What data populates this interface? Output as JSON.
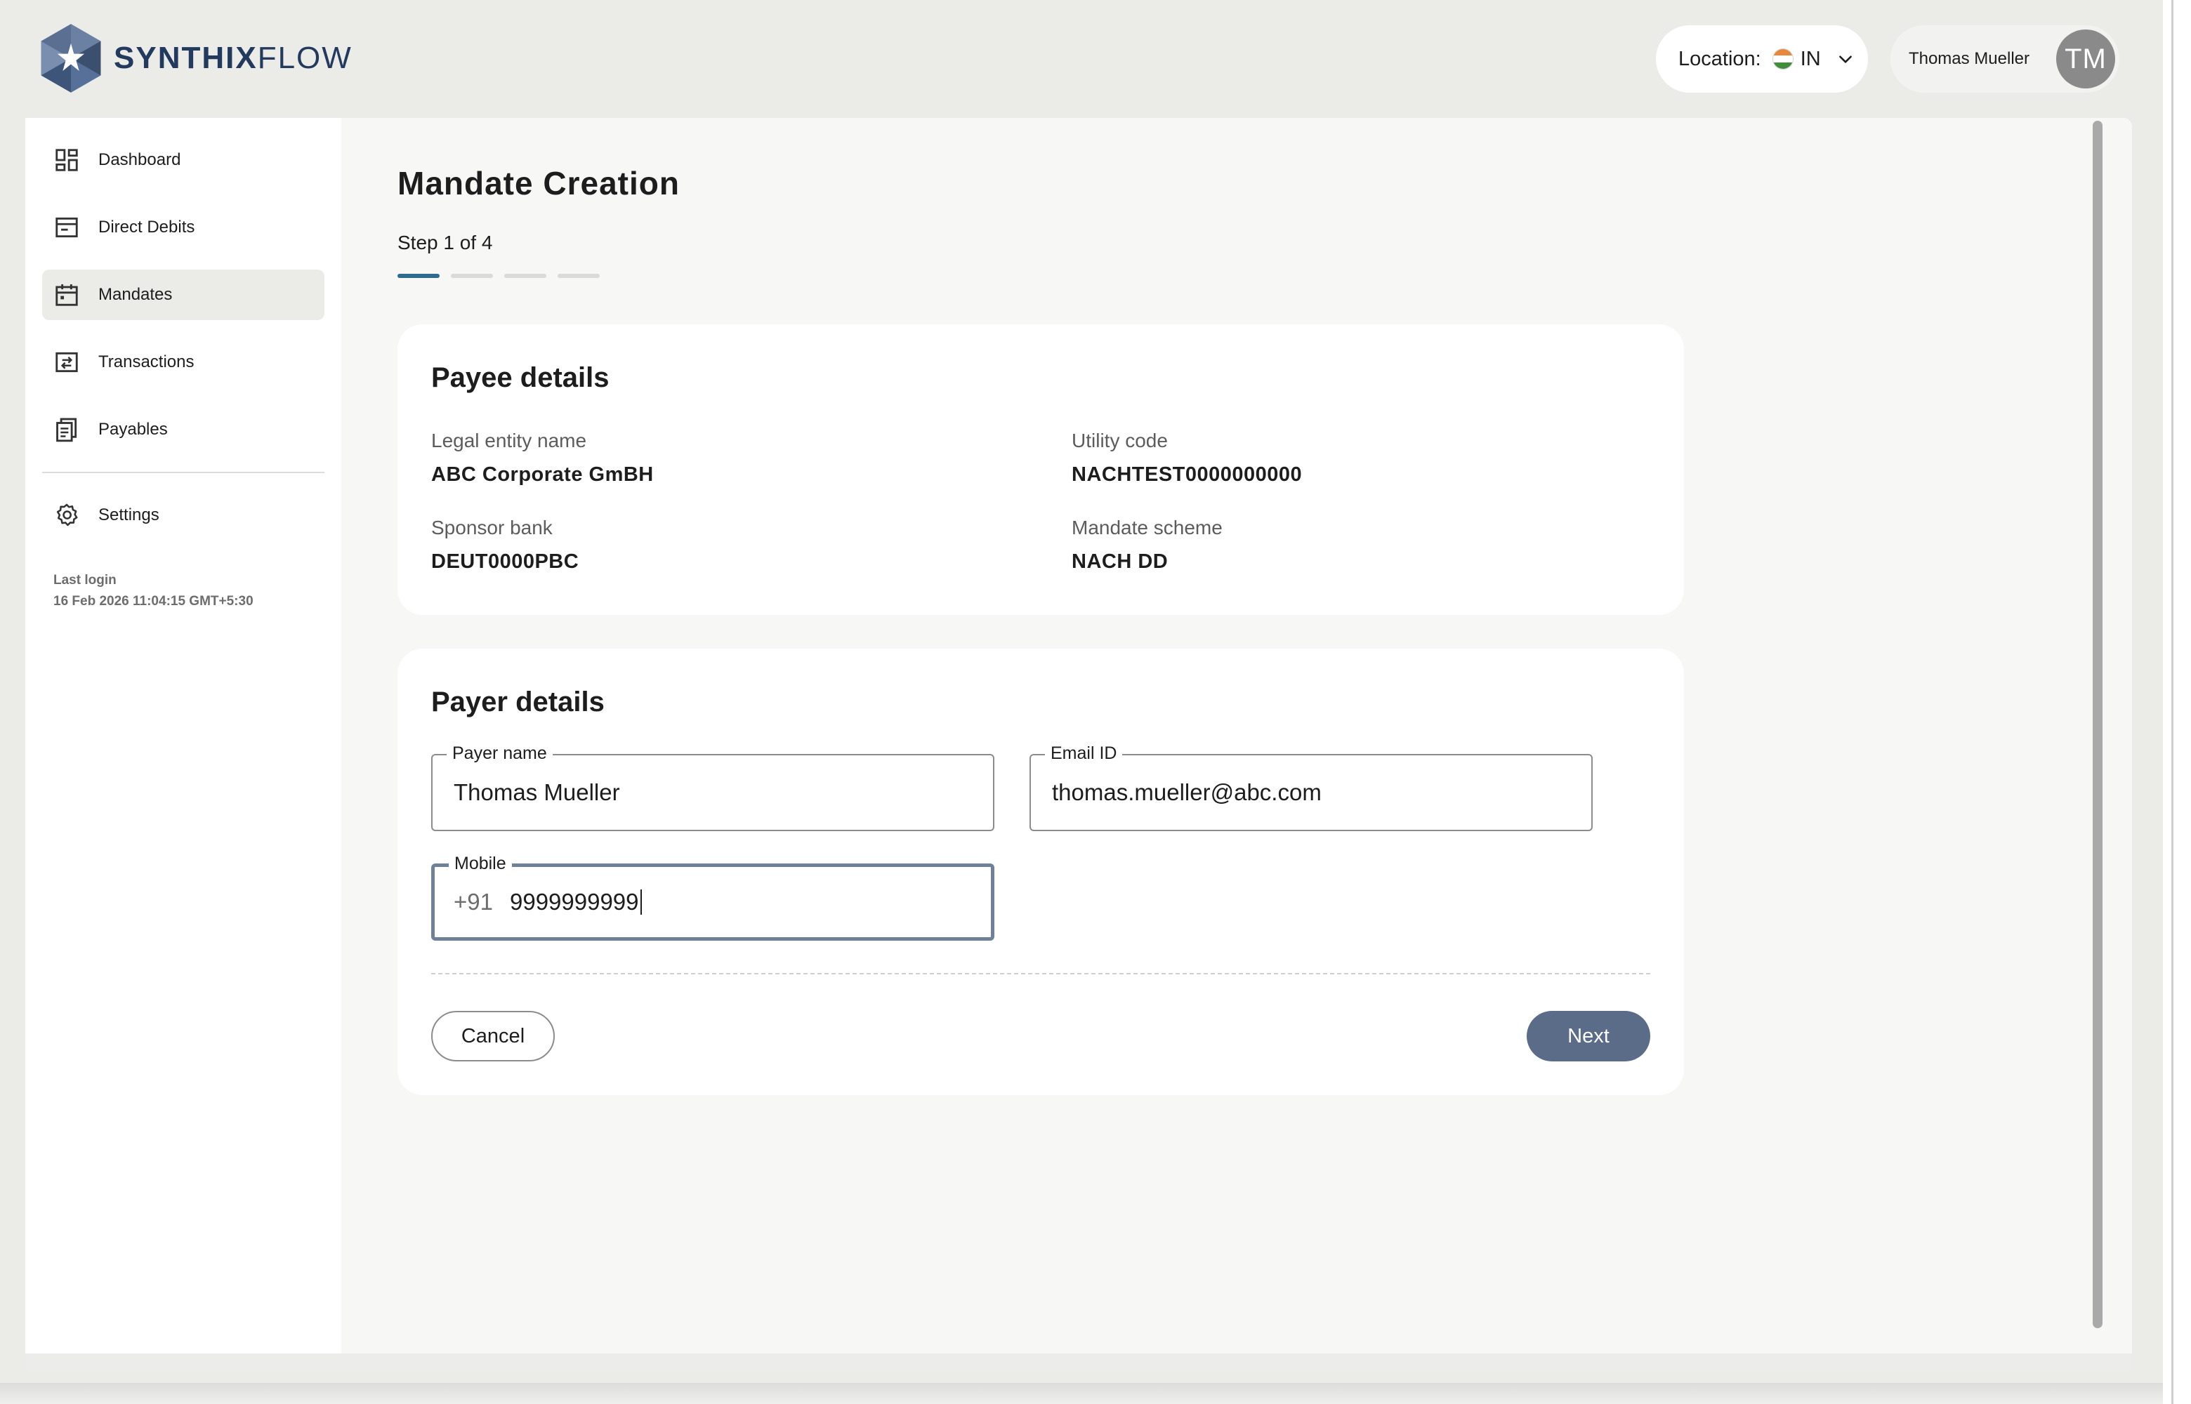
{
  "brand": {
    "name_bold": "SYNTHIX",
    "name_light": "FLOW",
    "primary": "#223a5e"
  },
  "header": {
    "location_label": "Location:",
    "location_code": "IN",
    "user_name": "Thomas Mueller",
    "user_initials": "TM"
  },
  "sidebar": {
    "items": [
      {
        "label": "Dashboard",
        "icon": "dashboard-icon"
      },
      {
        "label": "Direct Debits",
        "icon": "direct-debit-icon"
      },
      {
        "label": "Mandates",
        "icon": "calendar-icon",
        "active": true
      },
      {
        "label": "Transactions",
        "icon": "transfer-icon"
      },
      {
        "label": "Payables",
        "icon": "documents-icon"
      }
    ],
    "settings_label": "Settings",
    "last_login_label": "Last login",
    "last_login_value": "16 Feb 2026 11:04:15 GMT+5:30"
  },
  "page": {
    "title": "Mandate Creation",
    "step_label": "Step 1 of 4",
    "current_step": 1,
    "total_steps": 4
  },
  "payee": {
    "title": "Payee details",
    "fields": [
      {
        "label": "Legal entity name",
        "value": "ABC Corporate GmBH"
      },
      {
        "label": "Utility code",
        "value": "NACHTEST0000000000"
      },
      {
        "label": "Sponsor bank",
        "value": "DEUT0000PBC"
      },
      {
        "label": "Mandate scheme",
        "value": "NACH DD"
      }
    ]
  },
  "payer": {
    "title": "Payer details",
    "name_label": "Payer name",
    "name_value": "Thomas Mueller",
    "email_label": "Email ID",
    "email_value": "thomas.mueller@abc.com",
    "mobile_label": "Mobile",
    "mobile_prefix": "+91",
    "mobile_value": "9999999999"
  },
  "actions": {
    "cancel_label": "Cancel",
    "next_label": "Next"
  },
  "colors": {
    "accent": "#2f6b8c",
    "button_primary": "#5b6c89",
    "active_nav": "#ebebe8"
  }
}
